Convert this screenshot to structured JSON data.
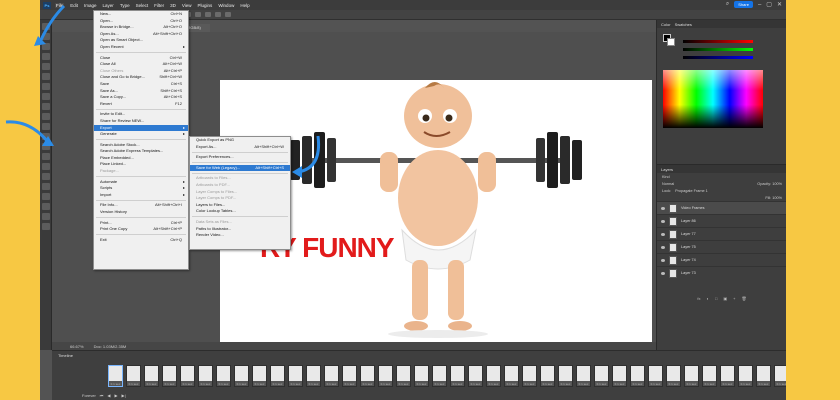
{
  "menubar": {
    "logo": "Ps",
    "items": [
      "File",
      "Edit",
      "Image",
      "Layer",
      "Type",
      "Select",
      "Filter",
      "3D",
      "View",
      "Plugins",
      "Window",
      "Help"
    ],
    "active": "File",
    "share": "Share"
  },
  "optbar": {
    "show_transform": "Show Transform Controls"
  },
  "document": {
    "tab": "@ 66.7% (Layer 1, RGB/8)"
  },
  "canvas": {
    "text": "RY FUNNY"
  },
  "status": {
    "zoom": "66.67%",
    "doc": "Doc: 1.03M/2.35M"
  },
  "timeline": {
    "title": "Timeline",
    "frames": [
      "0.1 sec",
      "0.1 sec",
      "0.1 sec",
      "0.1 sec",
      "0.1 sec",
      "0.1 sec",
      "0.1 sec",
      "0.1 sec",
      "0.1 sec",
      "0.1 sec",
      "0.1 sec",
      "0.1 sec",
      "0.1 sec",
      "0.1 sec",
      "0.1 sec",
      "0.1 sec",
      "0.1 sec",
      "0.1 sec",
      "0.1 sec",
      "0.1 sec",
      "0.1 sec",
      "0.1 sec",
      "0.1 sec",
      "0.1 sec",
      "0.1 sec",
      "0.1 sec",
      "0.1 sec",
      "0.1 sec",
      "0.1 sec",
      "0.1 sec",
      "0.1 sec",
      "0.1 sec",
      "0.1 sec",
      "0.1 sec",
      "0.1 sec",
      "0.1 sec",
      "0.1 sec",
      "0.1 sec",
      "0.1 sec",
      "0.1 sec",
      "0.1 sec",
      "0.1 sec"
    ],
    "loop": "Forever"
  },
  "panels": {
    "color_tabs": [
      "Color",
      "Swatches"
    ],
    "layers_tabs": [
      "Layers"
    ],
    "kind": "Kind",
    "blend": "Normal",
    "opacity": "Opacity: 100%",
    "lock": "Lock:",
    "propagate": "Propagate Frame 1",
    "fill": "Fill: 100%",
    "layers": [
      {
        "name": "Video Frames",
        "group": true
      },
      {
        "name": "Layer 86",
        "group": false
      },
      {
        "name": "Layer 77",
        "group": false
      },
      {
        "name": "Layer 75",
        "group": false
      },
      {
        "name": "Layer 74",
        "group": false
      },
      {
        "name": "Layer 73",
        "group": false
      }
    ],
    "footer": [
      "fx",
      "◐",
      "□",
      "▣",
      "+",
      "🗑"
    ]
  },
  "file_menu": [
    {
      "label": "New...",
      "sc": "Ctrl+N"
    },
    {
      "label": "Open...",
      "sc": "Ctrl+O"
    },
    {
      "label": "Browse in Bridge...",
      "sc": "Alt+Ctrl+O"
    },
    {
      "label": "Open As...",
      "sc": "Alt+Shift+Ctrl+O"
    },
    {
      "label": "Open as Smart Object...",
      "sc": ""
    },
    {
      "label": "Open Recent",
      "sc": "",
      "arrow": true
    },
    {
      "sep": true
    },
    {
      "label": "Close",
      "sc": "Ctrl+W"
    },
    {
      "label": "Close All",
      "sc": "Alt+Ctrl+W"
    },
    {
      "label": "Close Others",
      "sc": "Alt+Ctrl+P",
      "disabled": true
    },
    {
      "label": "Close and Go to Bridge...",
      "sc": "Shift+Ctrl+W"
    },
    {
      "label": "Save",
      "sc": "Ctrl+S"
    },
    {
      "label": "Save As...",
      "sc": "Shift+Ctrl+S"
    },
    {
      "label": "Save a Copy...",
      "sc": "Alt+Ctrl+S"
    },
    {
      "label": "Revert",
      "sc": "F12"
    },
    {
      "sep": true
    },
    {
      "label": "Invite to Edit...",
      "sc": ""
    },
    {
      "label": "Share for Review NEW...",
      "sc": ""
    },
    {
      "label": "Export",
      "sc": "",
      "arrow": true,
      "highlight": true
    },
    {
      "label": "Generate",
      "sc": "",
      "arrow": true
    },
    {
      "sep": true
    },
    {
      "label": "Search Adobe Stock...",
      "sc": ""
    },
    {
      "label": "Search Adobe Express Templates...",
      "sc": ""
    },
    {
      "label": "Place Embedded...",
      "sc": ""
    },
    {
      "label": "Place Linked...",
      "sc": ""
    },
    {
      "label": "Package...",
      "sc": "",
      "disabled": true
    },
    {
      "sep": true
    },
    {
      "label": "Automate",
      "sc": "",
      "arrow": true
    },
    {
      "label": "Scripts",
      "sc": "",
      "arrow": true
    },
    {
      "label": "Import",
      "sc": "",
      "arrow": true
    },
    {
      "sep": true
    },
    {
      "label": "File Info...",
      "sc": "Alt+Shift+Ctrl+I"
    },
    {
      "label": "Version History",
      "sc": ""
    },
    {
      "sep": true
    },
    {
      "label": "Print...",
      "sc": "Ctrl+P"
    },
    {
      "label": "Print One Copy",
      "sc": "Alt+Shift+Ctrl+P"
    },
    {
      "sep": true
    },
    {
      "label": "Exit",
      "sc": "Ctrl+Q"
    }
  ],
  "export_menu": [
    {
      "label": "Quick Export as PNG",
      "sc": ""
    },
    {
      "label": "Export As...",
      "sc": "Alt+Shift+Ctrl+W"
    },
    {
      "sep": true
    },
    {
      "label": "Export Preferences...",
      "sc": ""
    },
    {
      "sep": true
    },
    {
      "label": "Save for Web (Legacy)...",
      "sc": "Alt+Shift+Ctrl+S",
      "highlight": true
    },
    {
      "sep": true
    },
    {
      "label": "Artboards to Files...",
      "sc": "",
      "disabled": true
    },
    {
      "label": "Artboards to PDF...",
      "sc": "",
      "disabled": true
    },
    {
      "label": "Layer Comps to Files...",
      "sc": "",
      "disabled": true
    },
    {
      "label": "Layer Comps to PDF...",
      "sc": "",
      "disabled": true
    },
    {
      "label": "Layers to Files...",
      "sc": ""
    },
    {
      "label": "Color Lookup Tables...",
      "sc": ""
    },
    {
      "sep": true
    },
    {
      "label": "Data Sets as Files...",
      "sc": "",
      "disabled": true
    },
    {
      "label": "Paths to Illustrator...",
      "sc": ""
    },
    {
      "label": "Render Video...",
      "sc": ""
    }
  ],
  "colors": {
    "highlight": "#2e7ad1",
    "annotation_arrow": "#2b8be6",
    "funny_text": "#e21b1b"
  }
}
